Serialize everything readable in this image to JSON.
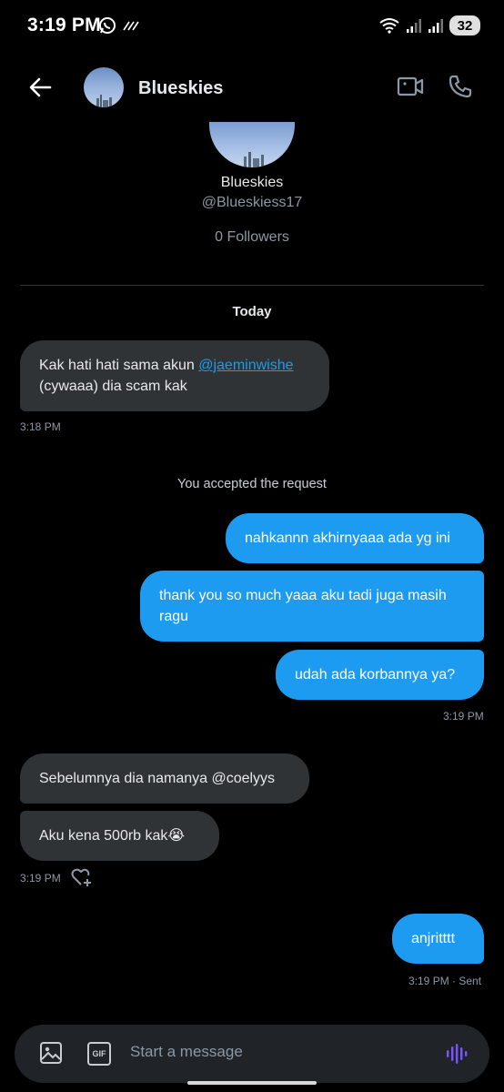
{
  "status_bar": {
    "time": "3:19 PM",
    "battery": "32"
  },
  "header": {
    "title": "Blueskies"
  },
  "profile": {
    "name": "Blueskies",
    "handle": "@Blueskiess17",
    "followers": "0 Followers"
  },
  "day_label": "Today",
  "messages": {
    "m1_before": "Kak hati hati sama akun ",
    "m1_mention": "@jaeminwishe",
    "m1_after": "(cywaaa) dia scam kak",
    "m1_time": "3:18 PM",
    "system": "You accepted the request",
    "m2": "nahkannn akhirnyaaa ada yg ini",
    "m3": "thank you so much yaaa aku tadi juga masih ragu",
    "m4": "udah ada korbannya ya?",
    "m4_time": "3:19 PM",
    "m5": "Sebelumnya dia namanya @coelyys",
    "m6": "Aku kena 500rb kak😭",
    "m6_time": "3:19 PM",
    "m7": "anjritttt",
    "m7_time": "3:19 PM · Sent"
  },
  "composer": {
    "placeholder": "Start a message",
    "gif_label": "GIF"
  },
  "colors": {
    "background": "#000000",
    "incoming_bubble": "#2f3336",
    "outgoing_bubble": "#1d9bf0",
    "muted_text": "#8b98a5",
    "voice_accent": "#7856ff"
  }
}
